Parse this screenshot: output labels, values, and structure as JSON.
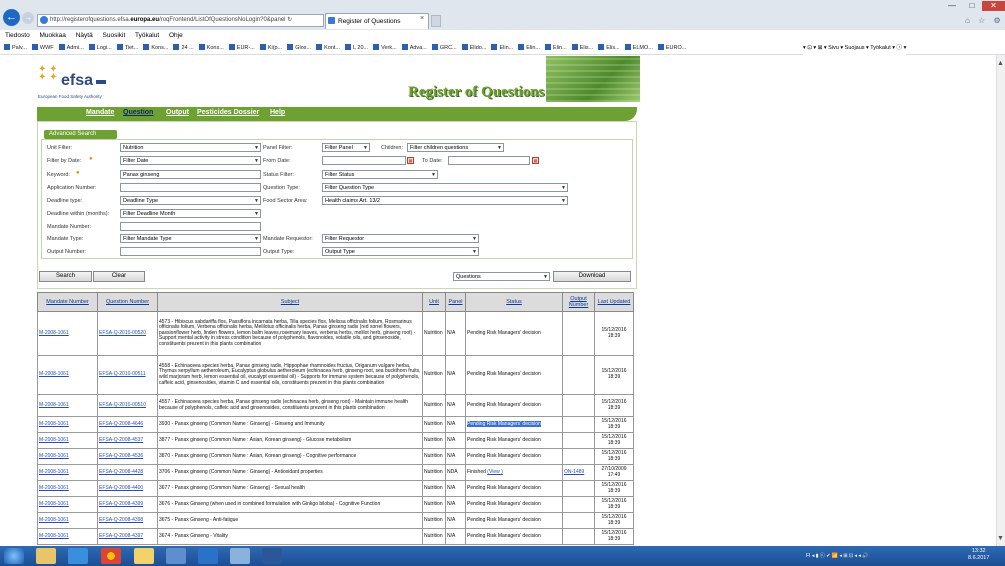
{
  "browser": {
    "url_pre": "http://registerofquestions.efsa.",
    "url_bold": "europa.eu",
    "url_post": "/roqFrontend/ListOfQuestionsNoLogin?0&panel",
    "url_tail": "↻",
    "tab_title": "Register of Questions",
    "tab_close": "×",
    "back": "←",
    "forward": "→",
    "win_min": "—",
    "win_max": "□",
    "win_close": "✕",
    "right_icons": "⌂ ☆ ⚙"
  },
  "menu": [
    "Tiedosto",
    "Muokkaa",
    "Näytä",
    "Suosikit",
    "Työkalut",
    "Ohje"
  ],
  "favorites": [
    "Palv...",
    "WWF",
    "Admi...",
    "Logi...",
    "Tiet...",
    "Kons...",
    "24 ...",
    "Kons...",
    "EUR-...",
    "Ki(p...",
    "Glos...",
    "Kont...",
    "L 20...",
    "Verk...",
    "Adva...",
    "GRC...",
    "Elido...",
    "Elin...",
    "Elin...",
    "Elin...",
    "Elis...",
    "Elis...",
    "ELMO...",
    "EURO..."
  ],
  "favorites_right": "▾ ⊡ ▾ ⊠ ▾ Sivu ▾  Suojaus ▾  Työkalut ▾  ⓘ ▾",
  "header": {
    "logo": "efsa",
    "logo_sub": "European Food Safety Authority",
    "title": "Register of Questions"
  },
  "nav": [
    "Mandate",
    "Question",
    "Output",
    "Pesticides Dossier",
    "Help"
  ],
  "search": {
    "section_label": "Advanced Search",
    "unit_filter_label": "Unit Filter:",
    "unit_filter_value": "Nutrition",
    "panel_filter_label": "Panel Filter:",
    "panel_filter_value": "Filter Panel",
    "children_label": "Children:",
    "children_value": "Filter children questions",
    "filter_by_date_label": "Filter by Date:",
    "filter_date_value": "Filter Date",
    "from_date_label": "From Date:",
    "from_date_value": "",
    "to_date_label": "To Date:",
    "to_date_value": "",
    "keyword_label": "Keyword:",
    "keyword_value": "Panax ginseng",
    "status_filter_label": "Status Filter:",
    "status_filter_value": "Filter Status",
    "application_number_label": "Application Number:",
    "application_number_value": "",
    "question_type_label": "Question Type:",
    "question_type_value": "Filter Question Type",
    "deadline_type_label": "Deadline type:",
    "deadline_type_value": "Deadline Type",
    "food_sector_label": "Food Sector Area:",
    "food_sector_value": "Health claims Art. 13/2",
    "deadline_within_label": "Deadline within (months):",
    "deadline_within_value": "Filter Deadline Month",
    "mandate_number_label": "Mandate Number:",
    "mandate_number_value": "",
    "mandate_type_label": "Mandate Type:",
    "mandate_type_value": "Filter Mandate Type",
    "mandate_requestor_label": "Mandate Requestor:",
    "mandate_requestor_value": "Filter Requestor",
    "output_number_label": "Output Number:",
    "output_number_value": "",
    "output_type_label": "Output Type:",
    "output_type_value": "Output Type",
    "search_button": "Search",
    "clear_button": "Clear",
    "download_type_value": "Questions",
    "download_button": "Download"
  },
  "table": {
    "headers": [
      "Mandate Number",
      "Question Number",
      "Subject",
      "Unit",
      "Panel",
      "Status",
      "Output Number",
      "Last Updated"
    ],
    "rows": [
      {
        "mandate": "M-2008-1061",
        "question": "EFSA-Q-2010-00520",
        "subject": "4573 - Hibiscus sabdariffa flos, Passiflora incarnata herba, Tilia species flos, Melissa officinalis folium, Rosmarinus officinalis folium, Verbena officinalis herba, Melilotus officinalis herba, Panax ginseng radix (red sorrel flowers, passionflower herb, linden flowers, lemon balm leaves,rosemary leaves, verbena herbs, melilot herb, ginseng root) - Support mental activity in stress condition because of polyphenols, flavonoides, volatile oils, and ginsenoside, constituents prezent in this plants combination",
        "unit": "Nutrition",
        "panel": "N/A",
        "status": "Pending Risk Managers' decision",
        "status_link": "",
        "output": "",
        "updated": "15/12/2016 18:39",
        "h": 44
      },
      {
        "mandate": "M-2008-1061",
        "question": "EFSA-Q-2010-00511",
        "subject": "4558 - Echinaceea species herba, Panax ginseng radix, Hippophae rhamnoides fructus, Origanum vulgare herba, Thymus serpyllum aetheroleum, Eucalyptus globulus aetheroleum (echinacea herb, ginseng root, sea buckthorn fruits, wild marjoram herb, lemon essential oil, eucalypt essential oil) - Supports for immune system because of polyphenols, caffeic acid, ginsenosides, vitamin C and essential oils, constituents prezent in this plants combination",
        "unit": "Nutrition",
        "panel": "N/A",
        "status": "Pending Risk Managers' decision",
        "status_link": "",
        "output": "",
        "updated": "15/12/2016 18:39",
        "h": 39
      },
      {
        "mandate": "M-2008-1061",
        "question": "EFSA-Q-2010-00510",
        "subject": "4557 - Echinaceea species herba, Panax ginseng radix (echinacea herb, ginseng root) - Maintain immune health because of polyphenols, caffeic acid and ginsenosides, constituents prezent in this plants combination",
        "unit": "Nutrition",
        "panel": "N/A",
        "status": "Pending Risk Managers' decision",
        "status_link": "",
        "output": "",
        "updated": "15/12/2016 18:39",
        "h": 22
      },
      {
        "mandate": "M-2008-1061",
        "question": "EFSA-Q-2008-4646",
        "subject": "3930 - Panax ginseng (Common Name : Ginseng) - Ginseng and Immunity",
        "unit": "Nutrition",
        "panel": "N/A",
        "status": "Pending Risk Managers' decision",
        "status_link": "",
        "output": "",
        "updated": "15/12/2016 18:39",
        "h": 16,
        "hl": true
      },
      {
        "mandate": "M-2008-1061",
        "question": "EFSA-Q-2008-4537",
        "subject": "3877 - Panax ginseng (Common Name : Asian, Korean ginseng) - Glucose metabolism",
        "unit": "Nutrition",
        "panel": "N/A",
        "status": "Pending Risk Managers' decision",
        "status_link": "",
        "output": "",
        "updated": "15/12/2016 18:39",
        "h": 16
      },
      {
        "mandate": "M-2008-1061",
        "question": "EFSA-Q-2008-4536",
        "subject": "3870 - Panax ginseng (Common Name : Asian, Korean ginseng) - Cognitive performance",
        "unit": "Nutrition",
        "panel": "N/A",
        "status": "Pending Risk Managers' decision",
        "status_link": "",
        "output": "",
        "updated": "15/12/2016 18:39",
        "h": 16
      },
      {
        "mandate": "M-2008-1061",
        "question": "EFSA-Q-2008-4428",
        "subject": "3706 - Panax ginseng (Common Name : Ginseng) - Antioxidant properties",
        "unit": "Nutrition",
        "panel": "NDA",
        "status": "Finished",
        "status_link": "(View )",
        "output": "ON-1489",
        "updated": "27/10/2009 17:49",
        "h": 16
      },
      {
        "mandate": "M-2008-1061",
        "question": "EFSA-Q-2008-4400",
        "subject": "3677 - Panax ginseng (Common Name : Ginseng) - Sexual health",
        "unit": "Nutrition",
        "panel": "N/A",
        "status": "Pending Risk Managers' decision",
        "status_link": "",
        "output": "",
        "updated": "15/12/2016 18:39",
        "h": 16
      },
      {
        "mandate": "M-2008-1061",
        "question": "EFSA-Q-2008-4399",
        "subject": "3676 - Panax Ginseng (when used in combined formulation with Ginkgo biloba) - Cognitive Function",
        "unit": "Nutrition",
        "panel": "N/A",
        "status": "Pending Risk Managers' decision",
        "status_link": "",
        "output": "",
        "updated": "15/12/2016 18:39",
        "h": 16
      },
      {
        "mandate": "M-2008-1061",
        "question": "EFSA-Q-2008-4398",
        "subject": "3675 - Panax Ginseng - Anti-fatigue",
        "unit": "Nutrition",
        "panel": "N/A",
        "status": "Pending Risk Managers' decision",
        "status_link": "",
        "output": "",
        "updated": "15/12/2016 18:39",
        "h": 16
      },
      {
        "mandate": "M-2008-1061",
        "question": "EFSA-Q-2008-4397",
        "subject": "3674 - Panax Ginseng - Vitality",
        "unit": "Nutrition",
        "panel": "N/A",
        "status": "Pending Risk Managers' decision",
        "status_link": "",
        "output": "",
        "updated": "15/12/2016 18:39",
        "h": 16
      }
    ]
  },
  "taskbar": {
    "tray": "FI ◂ ▮ ⓒ ✔ 📶 ◂ ⊞ ⊡ ◂ ◂ 🔊",
    "time": "13:32",
    "date": "8.6.2017"
  },
  "colors": {
    "accent": "#6da132",
    "link": "#2450b8",
    "highlight": "#3b6fd0"
  }
}
